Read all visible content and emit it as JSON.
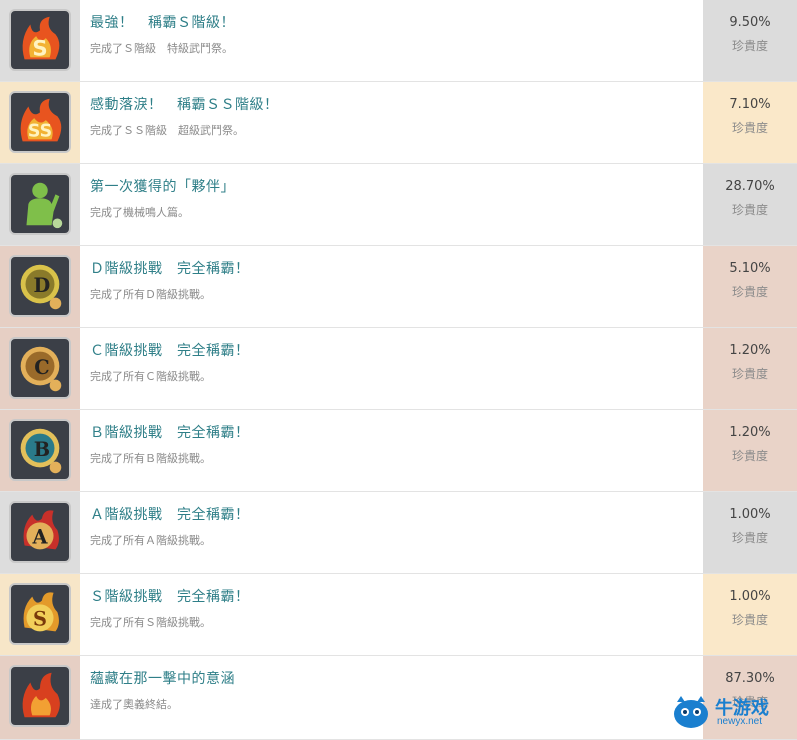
{
  "achievements": [
    {
      "title": "最強！　稱霸Ｓ階級！",
      "desc": "完成了Ｓ階級　特級武鬥祭。",
      "rarity": "9.50%",
      "rarity_label": "珍貴度",
      "icon": "s-rank-flame-icon",
      "icon_colors": [
        "#e8541f",
        "#f2b233"
      ],
      "icon_bg": "#dddddd",
      "rarity_bg": "#dcdcdc"
    },
    {
      "title": "感動落淚！　稱霸ＳＳ階級！",
      "desc": "完成了ＳＳ階級　超級武鬥祭。",
      "rarity": "7.10%",
      "rarity_label": "珍貴度",
      "icon": "ss-rank-flame-icon",
      "icon_colors": [
        "#e8541f",
        "#f2b233"
      ],
      "icon_bg": "#f7e6c8",
      "rarity_bg": "#fae8c9"
    },
    {
      "title": "第一次獲得的「夥伴」",
      "desc": "完成了機械鳴人篇。",
      "rarity": "28.70%",
      "rarity_label": "珍貴度",
      "icon": "partner-silhouette-icon",
      "icon_colors": [
        "#7fbf4a",
        "#b8d99a"
      ],
      "icon_bg": "#dddddd",
      "rarity_bg": "#dcdcdc"
    },
    {
      "title": "Ｄ階級挑戰　完全稱霸！",
      "desc": "完成了所有Ｄ階級挑戰。",
      "rarity": "5.10%",
      "rarity_label": "珍貴度",
      "icon": "d-rank-medal-icon",
      "icon_colors": [
        "#8a7a2a",
        "#d9c24a"
      ],
      "icon_bg": "#e6cfc4",
      "rarity_bg": "#e9d3c8"
    },
    {
      "title": "Ｃ階級挑戰　完全稱霸！",
      "desc": "完成了所有Ｃ階級挑戰。",
      "rarity": "1.20%",
      "rarity_label": "珍貴度",
      "icon": "c-rank-medal-icon",
      "icon_colors": [
        "#9a6a2a",
        "#e3b05a"
      ],
      "icon_bg": "#e6cfc4",
      "rarity_bg": "#e9d3c8"
    },
    {
      "title": "Ｂ階級挑戰　完全稱霸！",
      "desc": "完成了所有Ｂ階級挑戰。",
      "rarity": "1.20%",
      "rarity_label": "珍貴度",
      "icon": "b-rank-medal-icon",
      "icon_colors": [
        "#2a7a8a",
        "#e3c05a"
      ],
      "icon_bg": "#e6cfc4",
      "rarity_bg": "#e9d3c8"
    },
    {
      "title": "Ａ階級挑戰　完全稱霸！",
      "desc": "完成了所有Ａ階級挑戰。",
      "rarity": "1.00%",
      "rarity_label": "珍貴度",
      "icon": "a-rank-medal-icon",
      "icon_colors": [
        "#c8302a",
        "#e3b05a"
      ],
      "icon_bg": "#dddddd",
      "rarity_bg": "#dcdcdc"
    },
    {
      "title": "Ｓ階級挑戰　完全稱霸！",
      "desc": "完成了所有Ｓ階級挑戰。",
      "rarity": "1.00%",
      "rarity_label": "珍貴度",
      "icon": "s-rank-medal-icon",
      "icon_colors": [
        "#e39a2a",
        "#f2cf5a"
      ],
      "icon_bg": "#f7e6c8",
      "rarity_bg": "#fae8c9"
    },
    {
      "title": "蘊藏在那一擊中的意涵",
      "desc": "達成了奧義終結。",
      "rarity": "87.30%",
      "rarity_label": "珍貴度",
      "icon": "flame-fist-icon",
      "icon_colors": [
        "#d8401f",
        "#f2a033"
      ],
      "icon_bg": "#e6cfc4",
      "rarity_bg": "#e9d3c8"
    }
  ],
  "watermark": {
    "text": "牛游戏",
    "sub": "newyx.net",
    "color": "#1a7fcf"
  }
}
